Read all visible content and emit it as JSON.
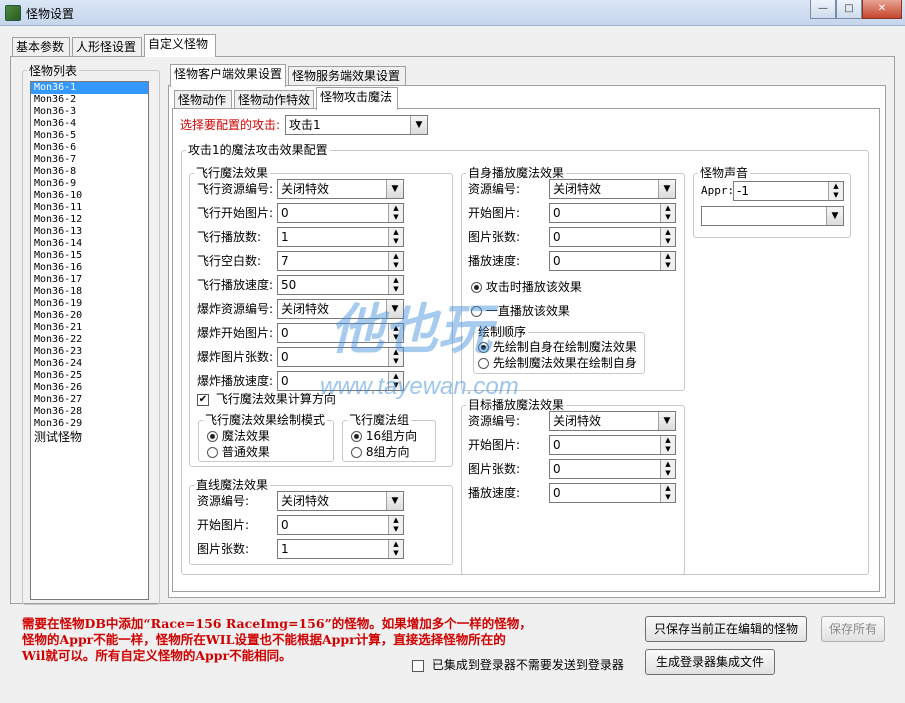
{
  "window": {
    "title": "怪物设置",
    "minimize_glyph": "—",
    "maximize_glyph": "□",
    "close_glyph": "✕"
  },
  "main_tabs": [
    "基本参数",
    "人形怪设置",
    "自定义怪物"
  ],
  "monster_list": {
    "title": "怪物列表",
    "items": [
      "Mon36-1",
      "Mon36-2",
      "Mon36-3",
      "Mon36-4",
      "Mon36-5",
      "Mon36-6",
      "Mon36-7",
      "Mon36-8",
      "Mon36-9",
      "Mon36-10",
      "Mon36-11",
      "Mon36-12",
      "Mon36-13",
      "Mon36-14",
      "Mon36-15",
      "Mon36-16",
      "Mon36-17",
      "Mon36-18",
      "Mon36-19",
      "Mon36-20",
      "Mon36-21",
      "Mon36-22",
      "Mon36-23",
      "Mon36-24",
      "Mon36-25",
      "Mon36-26",
      "Mon36-27",
      "Mon36-28",
      "Mon36-29",
      "测试怪物"
    ],
    "selected_index": 0
  },
  "effect_tabs": [
    "怪物客户端效果设置",
    "怪物服务端效果设置"
  ],
  "sub_tabs": [
    "怪物动作",
    "怪物动作特效",
    "怪物攻击魔法"
  ],
  "attack_select": {
    "label": "选择要配置的攻击:",
    "value": "攻击1"
  },
  "magic_config": {
    "title": "攻击1的魔法攻击效果配置",
    "fly": {
      "title": "飞行魔法效果",
      "fields": [
        {
          "label": "飞行资源编号:",
          "value": "关闭特效",
          "kind": "dropdown"
        },
        {
          "label": "飞行开始图片:",
          "value": "0",
          "kind": "spin"
        },
        {
          "label": "飞行播放数:",
          "value": "1",
          "kind": "spin"
        },
        {
          "label": "飞行空白数:",
          "value": "7",
          "kind": "spin"
        },
        {
          "label": "飞行播放速度:",
          "value": "50",
          "kind": "spin"
        },
        {
          "label": "爆炸资源编号:",
          "value": "关闭特效",
          "kind": "dropdown"
        },
        {
          "label": "爆炸开始图片:",
          "value": "0",
          "kind": "spin"
        },
        {
          "label": "爆炸图片张数:",
          "value": "0",
          "kind": "spin"
        },
        {
          "label": "爆炸播放速度:",
          "value": "0",
          "kind": "spin"
        }
      ],
      "calc_direction": {
        "label": "飞行魔法效果计算方向",
        "checked": true
      },
      "draw_mode": {
        "title": "飞行魔法效果绘制模式",
        "options": [
          "魔法效果",
          "普通效果"
        ],
        "selected": 0
      },
      "group": {
        "title": "飞行魔法组",
        "options": [
          "16组方向",
          "8组方向"
        ],
        "selected": 0
      }
    },
    "line": {
      "title": "直线魔法效果",
      "fields": [
        {
          "label": "资源编号:",
          "value": "关闭特效",
          "kind": "dropdown"
        },
        {
          "label": "开始图片:",
          "value": "0",
          "kind": "spin"
        },
        {
          "label": "图片张数:",
          "value": "1",
          "kind": "spin"
        }
      ]
    },
    "self": {
      "title": "自身播放魔法效果",
      "fields": [
        {
          "label": "资源编号:",
          "value": "关闭特效",
          "kind": "dropdown"
        },
        {
          "label": "开始图片:",
          "value": "0",
          "kind": "spin"
        },
        {
          "label": "图片张数:",
          "value": "0",
          "kind": "spin"
        },
        {
          "label": "播放速度:",
          "value": "0",
          "kind": "spin"
        }
      ],
      "play_options": [
        "攻击时播放该效果",
        "一直播放该效果"
      ],
      "play_selected": 0,
      "draw_order": {
        "title": "绘制顺序",
        "options": [
          "先绘制自身在绘制魔法效果",
          "先绘制魔法效果在绘制自身"
        ],
        "selected": 0
      }
    },
    "target": {
      "title": "目标播放魔法效果",
      "fields": [
        {
          "label": "资源编号:",
          "value": "关闭特效",
          "kind": "dropdown"
        },
        {
          "label": "开始图片:",
          "value": "0",
          "kind": "spin"
        },
        {
          "label": "图片张数:",
          "value": "0",
          "kind": "spin"
        },
        {
          "label": "播放速度:",
          "value": "0",
          "kind": "spin"
        }
      ]
    },
    "sound": {
      "title": "怪物声音",
      "appr_label": "Appr:",
      "appr_value": "-1",
      "dropdown_value": ""
    }
  },
  "note_lines": [
    "需要在怪物DB中添加“Race=156 RaceImg=156”的怪物。如果增加多个一样的怪物，",
    "怪物的Appr不能一样，怪物所在WIL设置也不能根据Appr计算，直接选择怪物所在的",
    "Wil就可以。所有自定义怪物的Appr不能相同。"
  ],
  "buttons": {
    "save_current": "只保存当前正在编辑的怪物",
    "save_all": "保存所有",
    "generate": "生成登录器集成文件"
  },
  "integrated_check": {
    "label": "已集成到登录器不需要发送到登录器",
    "checked": false
  },
  "watermark": {
    "logo": "他也玩",
    "url": "www.tayewan.com"
  }
}
